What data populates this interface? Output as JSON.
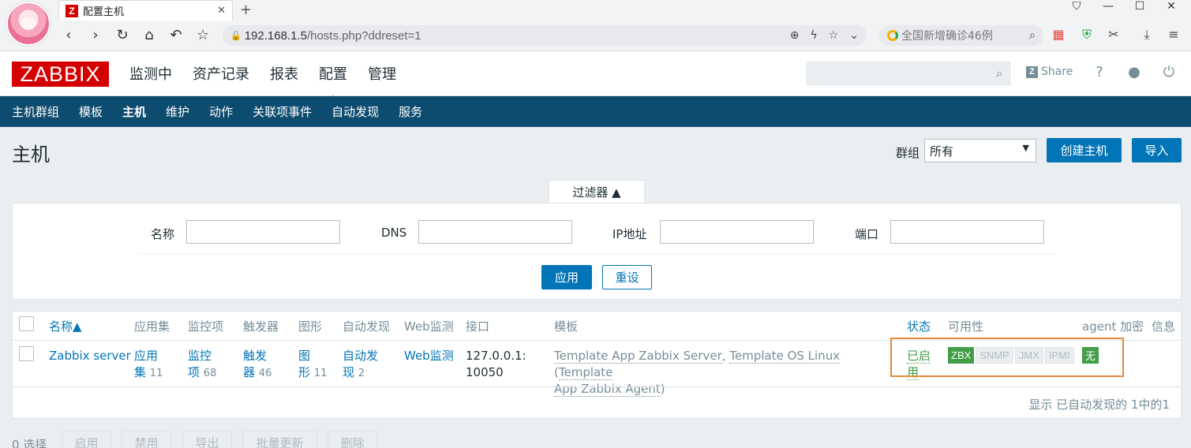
{
  "browser": {
    "tab_title": "配置主机",
    "favicon_letter": "Z",
    "url_host": "192.168.1.5",
    "url_path": "/hosts.php?ddreset=1",
    "search_placeholder": "全国新增确诊46例"
  },
  "header": {
    "logo": "ZABBIX",
    "nav": [
      "监测中",
      "资产记录",
      "报表",
      "配置",
      "管理"
    ],
    "active_nav": "配置",
    "share_label": "Share",
    "help_icon": "?"
  },
  "subnav": {
    "items": [
      "主机群组",
      "模板",
      "主机",
      "维护",
      "动作",
      "关联项事件",
      "自动发现",
      "服务"
    ],
    "active": "主机"
  },
  "page": {
    "title": "主机",
    "group_label": "群组",
    "group_value": "所有",
    "create_button": "创建主机",
    "import_button": "导入"
  },
  "filter": {
    "tab_label": "过滤器 ▲",
    "name_label": "名称",
    "dns_label": "DNS",
    "ip_label": "IP地址",
    "port_label": "端口",
    "apply_button": "应用",
    "reset_button": "重设"
  },
  "table": {
    "headers": {
      "name": "名称▲",
      "applications": "应用集",
      "items": "监控项",
      "triggers": "触发器",
      "graphs": "图形",
      "discovery": "自动发现",
      "web": "Web监测",
      "interface": "接口",
      "templates": "模板",
      "status": "状态",
      "availability": "可用性",
      "encryption": "agent 加密",
      "info": "信息"
    },
    "row": {
      "name": "Zabbix server",
      "app_a": "应用",
      "app_b": "集",
      "app_count": "11",
      "items_a": "监控",
      "items_b": "项",
      "items_count": "68",
      "trig_a": "触发",
      "trig_b": "器",
      "trig_count": "46",
      "graph_a": "图",
      "graph_b": "形",
      "graph_count": "11",
      "disc_a": "自动发",
      "disc_b": "现",
      "disc_count": "2",
      "web": "Web监测",
      "iface_a": "127.0.0.1:",
      "iface_b": "10050",
      "tpl_1": "Template App Zabbix Server",
      "tpl_sep": ", ",
      "tpl_2": "Template OS Linux",
      "tpl_open": " (",
      "tpl_3a": "Template",
      "tpl_3b": "App Zabbix Agent",
      "tpl_close": ")",
      "status_a": "已启",
      "status_b": "用",
      "avail": [
        "ZBX",
        "SNMP",
        "JMX",
        "IPMI"
      ],
      "encryption": "无"
    },
    "pager": "显示 已自动发现的 1中的1"
  },
  "actions": {
    "selected": "0 选择",
    "buttons": [
      "启用",
      "禁用",
      "导出",
      "批量更新",
      "删除"
    ]
  },
  "colors": {
    "brand_red": "#d40000",
    "nav_blue": "#0e4c6f",
    "link_blue": "#0275b8",
    "green": "#429e47",
    "highlight_orange": "#e8893a"
  }
}
